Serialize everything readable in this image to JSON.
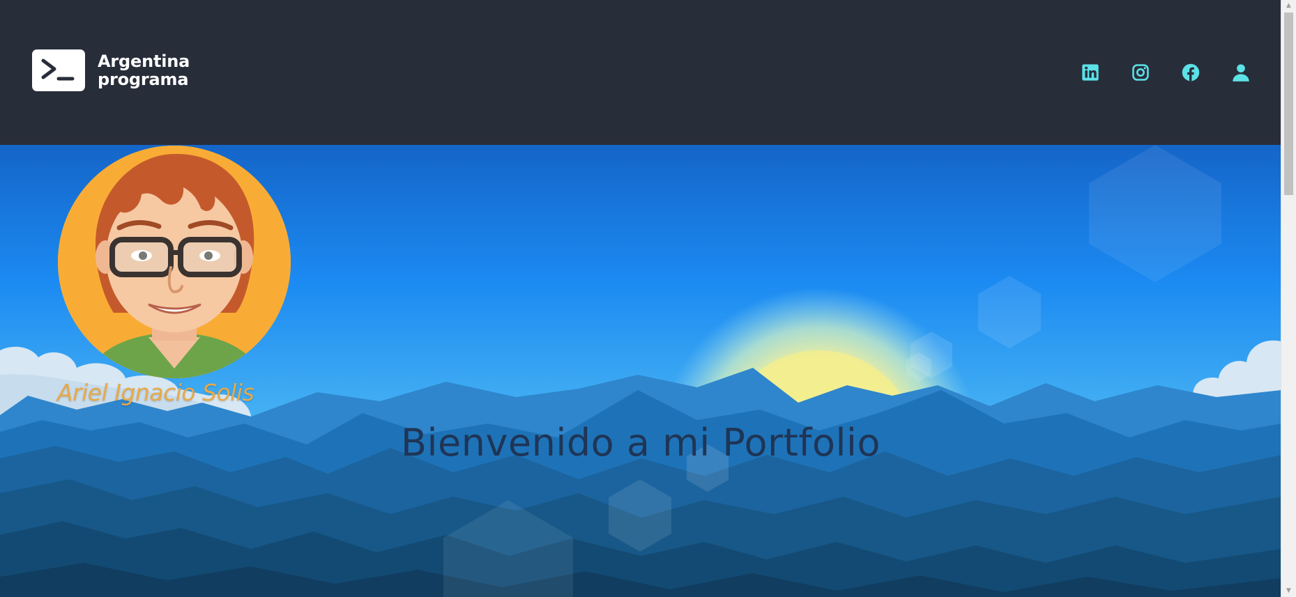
{
  "header": {
    "logo": {
      "line1": "Argentina",
      "line2": "programa"
    },
    "social_icons": [
      "linkedin-icon",
      "instagram-icon",
      "facebook-icon",
      "user-icon"
    ],
    "accent_color": "#5ce1e6"
  },
  "hero": {
    "person_name": "Ariel Ignacio Solis",
    "welcome_title": "Bienvenido a mi Portfolio",
    "avatar": "cartoon-portrait"
  },
  "colors": {
    "header_bg": "#282d3a",
    "name_color": "#e8a948",
    "title_color": "#1f3556",
    "sky_top": "#1565c8",
    "sky_bottom": "#6cc6f0"
  }
}
